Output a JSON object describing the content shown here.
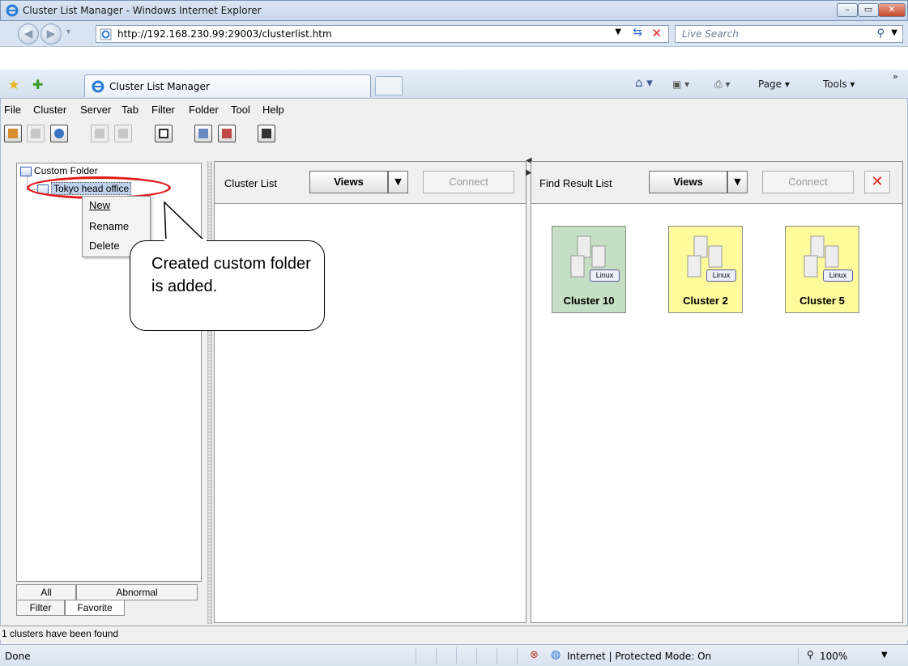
{
  "window": {
    "title": "Cluster List Manager - Windows Internet Explorer",
    "url": "http://192.168.230.99:29003/clusterlist.htm",
    "search_placeholder": "Live Search",
    "tab_title": "Cluster List Manager",
    "commands": {
      "page": "Page ▾",
      "tools": "Tools ▾"
    }
  },
  "menu": [
    "File",
    "Cluster",
    "Server",
    "Tab",
    "Filter",
    "Folder",
    "Tool",
    "Help"
  ],
  "tree": {
    "root": "Custom Folder",
    "child": "Tokyo head office"
  },
  "context_menu": [
    "New",
    "Rename",
    "Delete"
  ],
  "left_tabs": {
    "all": "All",
    "abnormal": "Abnormal",
    "filter": "Filter",
    "favorite": "Favorite"
  },
  "cluster_list": {
    "title": "Cluster List",
    "views": "Views",
    "connect": "Connect"
  },
  "find_result": {
    "title": "Find Result List",
    "views": "Views",
    "connect": "Connect",
    "close": "✕",
    "clusters": [
      {
        "name": "Cluster 10",
        "os": "Linux",
        "status_color": "#c4dfc3"
      },
      {
        "name": "Cluster 2",
        "os": "Linux",
        "status_color": "#fdfb9b"
      },
      {
        "name": "Cluster 5",
        "os": "Linux",
        "status_color": "#fdfb9b"
      }
    ]
  },
  "status_message": "1 clusters have been found",
  "ie_status": {
    "done": "Done",
    "zone": "Internet | Protected Mode: On",
    "zoom": "100%"
  },
  "callout": "Created custom folder is added."
}
